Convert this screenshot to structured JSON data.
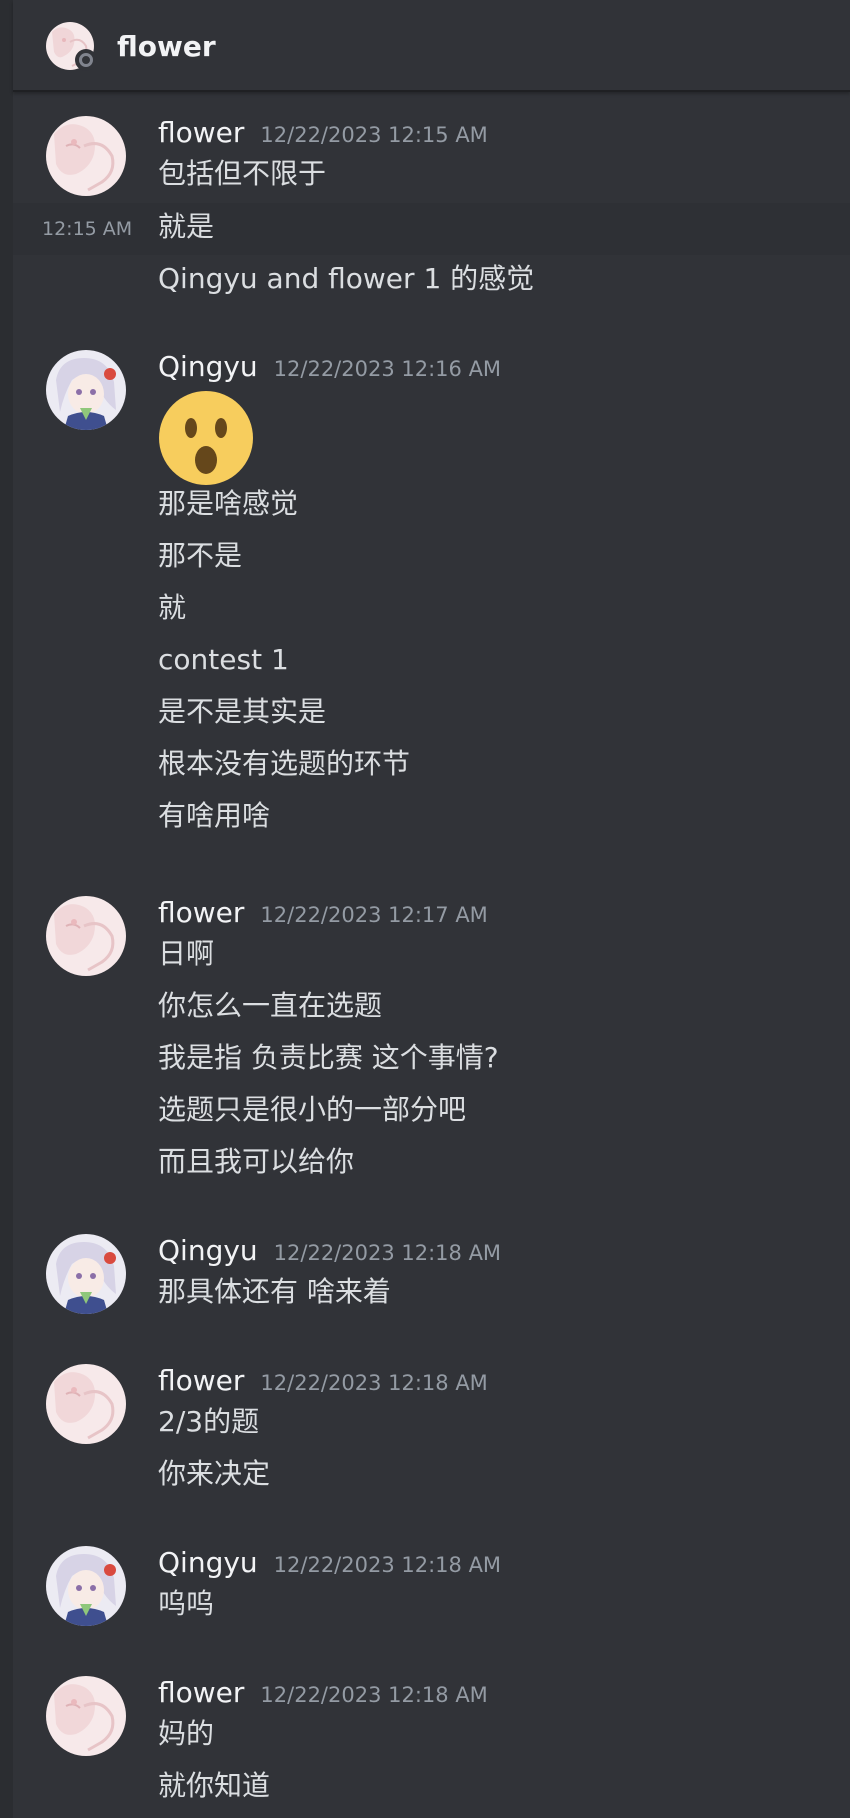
{
  "header": {
    "title": "flower"
  },
  "groups": [
    {
      "author": "flower",
      "timestamp": "12/22/2023 12:15 AM",
      "hover_time": "12:15 AM",
      "lines": [
        "包括但不限于",
        "就是",
        "Qingyu and flower 1 的感觉"
      ]
    },
    {
      "author": "Qingyu",
      "timestamp": "12/22/2023 12:16 AM",
      "emoji": "hushed-face-emoji",
      "lines": [
        "那是啥感觉",
        "那不是",
        "就",
        "contest 1",
        "是不是其实是",
        "根本没有选题的环节",
        "有啥用啥"
      ]
    },
    {
      "author": "flower",
      "timestamp": "12/22/2023 12:17 AM",
      "lines": [
        "日啊",
        "你怎么一直在选题",
        "我是指 负责比赛 这个事情?",
        "选题只是很小的一部分吧",
        "而且我可以给你"
      ]
    },
    {
      "author": "Qingyu",
      "timestamp": "12/22/2023 12:18 AM",
      "lines": [
        "那具体还有 啥来着"
      ]
    },
    {
      "author": "flower",
      "timestamp": "12/22/2023 12:18 AM",
      "lines": [
        "2/3的题",
        "你来决定"
      ]
    },
    {
      "author": "Qingyu",
      "timestamp": "12/22/2023 12:18 AM",
      "lines": [
        "呜呜"
      ]
    },
    {
      "author": "flower",
      "timestamp": "12/22/2023 12:18 AM",
      "lines": [
        "妈的",
        "就你知道"
      ]
    }
  ],
  "colors": {
    "background": "#313338",
    "header_text": "#f2f3f5",
    "message_text": "#dbdee1",
    "timestamp": "#949ba4",
    "emoji_yellow": "#f7cd5d"
  }
}
